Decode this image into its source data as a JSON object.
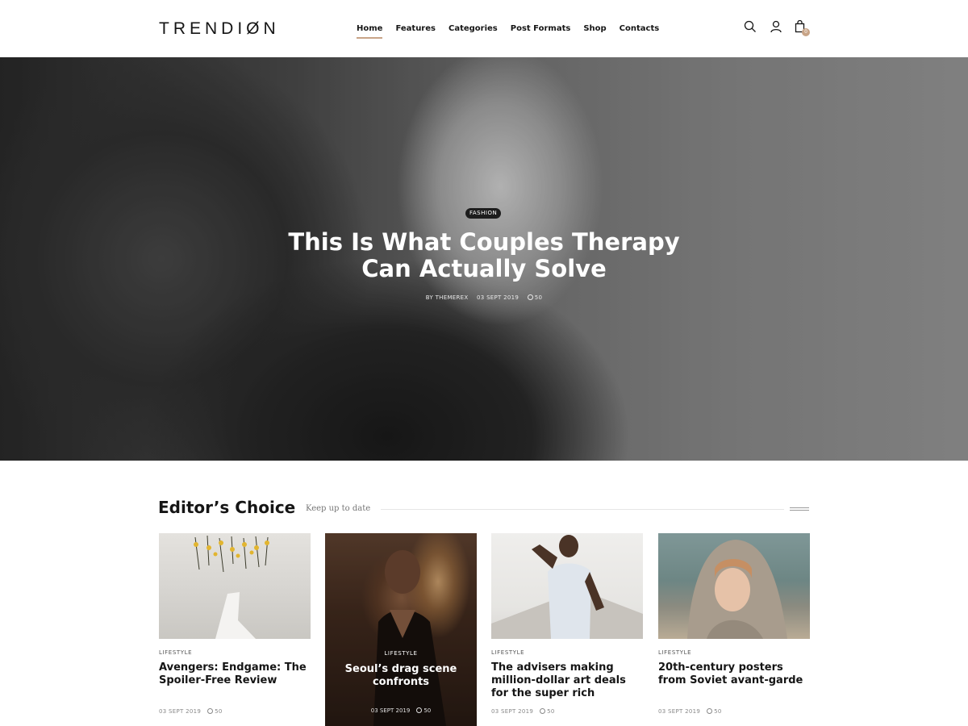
{
  "header": {
    "logo": "TRENDIØN",
    "nav": [
      "Home",
      "Features",
      "Categories",
      "Post Formats",
      "Shop",
      "Contacts"
    ],
    "cart_count": "0"
  },
  "hero": {
    "category": "FASHION",
    "title_line1": "This Is What Couples Therapy",
    "title_line2": "Can Actually Solve",
    "author": "BY THEMEREX",
    "date": "03 SEPT 2019",
    "comments": "50"
  },
  "editors_choice": {
    "title": "Editor’s Choice",
    "subtitle": "Keep up to date",
    "cards": [
      {
        "category": "LIFESTYLE",
        "title": "Avengers: Endgame: The Spoiler-Free Review",
        "date": "03 SEPT 2019",
        "comments": "50"
      },
      {
        "category": "LIFESTYLE",
        "title": "Seoul’s drag scene confronts",
        "date": "03 SEPT 2019",
        "comments": "50"
      },
      {
        "category": "LIFESTYLE",
        "title": "The advisers making million-dollar art deals for the super rich",
        "date": "03 SEPT 2019",
        "comments": "50"
      },
      {
        "category": "LIFESTYLE",
        "title": "20th-century posters from Soviet avant-garde",
        "date": "03 SEPT 2019",
        "comments": "50"
      }
    ]
  },
  "colors": {
    "accent": "#c8a487",
    "text": "#151515"
  }
}
